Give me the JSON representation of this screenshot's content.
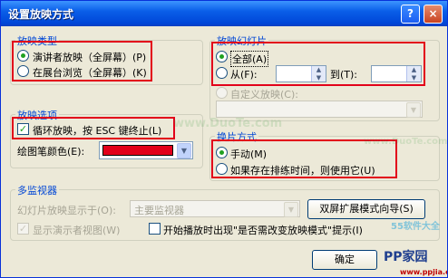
{
  "window": {
    "title": "设置放映方式",
    "help": "?",
    "close": "×"
  },
  "slideshow_type": {
    "title": "放映类型",
    "presenter": "演讲者放映（全屏幕）(P)",
    "browser": "在展台浏览（全屏幕）(K)"
  },
  "show_slides": {
    "title": "放映幻灯片",
    "all": "全部(A)",
    "from": "从(F):",
    "to": "到(T):",
    "from_value": "",
    "to_value": "",
    "custom": "自定义放映(C):"
  },
  "options": {
    "title": "放映选项",
    "loop": "循环放映，按 ESC 键终止(L)",
    "pen_color_label": "绘图笔颜色(E):",
    "pen_color": "#e2001a"
  },
  "advance": {
    "title": "换片方式",
    "manual": "手动(M)",
    "timings": "如果存在排练时间，则使用它(U)"
  },
  "multi_monitor": {
    "title": "多监视器",
    "display_label": "幻灯片放映显示于(O):",
    "display_value": "主要监视器",
    "presenter_view": "显示演示者视图(W)"
  },
  "buttons": {
    "dual_screen": "双屏扩展模式向导(S)",
    "confirm": "确定"
  },
  "prompt": {
    "text": "开始播放时出现\"是否需改变放映模式\"提示(I)"
  },
  "watermarks": {
    "site1": "www.DuoTe.com",
    "site2": "www.DuoTe.com",
    "logo1": "55软件大全",
    "logo2": "PP家园",
    "url": "www.ppjia.com"
  }
}
